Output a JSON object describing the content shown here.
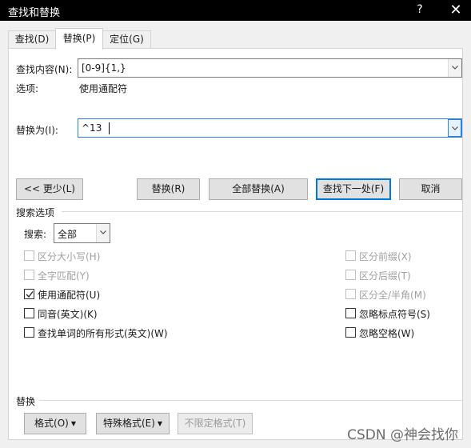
{
  "window": {
    "title": "查找和替换",
    "help": "?",
    "close": "✕"
  },
  "tabs": [
    {
      "label": "查找(D)",
      "active": false
    },
    {
      "label": "替换(P)",
      "active": true
    },
    {
      "label": "定位(G)",
      "active": false
    }
  ],
  "find": {
    "label": "查找内容(N):",
    "value": "[0-9]{1,}",
    "options_label": "选项:",
    "options_value": "使用通配符"
  },
  "replace": {
    "label": "替换为(I):",
    "value": "^13"
  },
  "buttons": {
    "less": "<< 更少(L)",
    "replace": "替换(R)",
    "replace_all": "全部替换(A)",
    "find_next": "查找下一处(F)",
    "cancel": "取消"
  },
  "search_options": {
    "section_title": "搜索选项",
    "search_label": "搜索:",
    "search_value": "全部",
    "left_checks": [
      {
        "label": "区分大小写(H)",
        "checked": false,
        "enabled": false
      },
      {
        "label": "全字匹配(Y)",
        "checked": false,
        "enabled": false
      },
      {
        "label": "使用通配符(U)",
        "checked": true,
        "enabled": true
      },
      {
        "label": "同音(英文)(K)",
        "checked": false,
        "enabled": true
      },
      {
        "label": "查找单词的所有形式(英文)(W)",
        "checked": false,
        "enabled": true
      }
    ],
    "right_checks": [
      {
        "label": "区分前缀(X)",
        "checked": false,
        "enabled": false
      },
      {
        "label": "区分后缀(T)",
        "checked": false,
        "enabled": false
      },
      {
        "label": "区分全/半角(M)",
        "checked": false,
        "enabled": false
      },
      {
        "label": "忽略标点符号(S)",
        "checked": false,
        "enabled": true
      },
      {
        "label": "忽略空格(W)",
        "checked": false,
        "enabled": true
      }
    ]
  },
  "replace_section": {
    "title": "替换",
    "format": "格式(O)",
    "special": "特殊格式(E)",
    "no_format": "不限定格式(T)"
  },
  "watermark": "CSDN @神会找你"
}
